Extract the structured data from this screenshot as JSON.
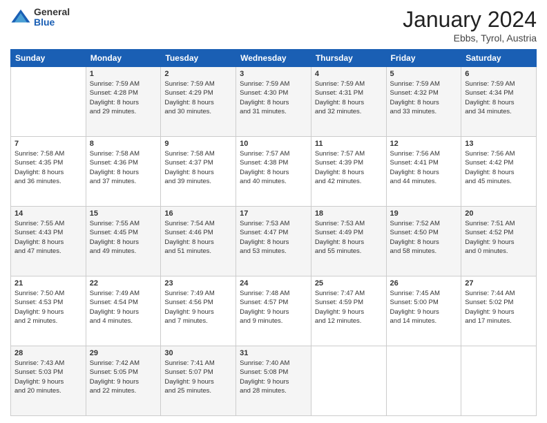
{
  "logo": {
    "general": "General",
    "blue": "Blue"
  },
  "header": {
    "month_year": "January 2024",
    "location": "Ebbs, Tyrol, Austria"
  },
  "weekdays": [
    "Sunday",
    "Monday",
    "Tuesday",
    "Wednesday",
    "Thursday",
    "Friday",
    "Saturday"
  ],
  "weeks": [
    [
      {
        "day": "",
        "info": ""
      },
      {
        "day": "1",
        "info": "Sunrise: 7:59 AM\nSunset: 4:28 PM\nDaylight: 8 hours\nand 29 minutes."
      },
      {
        "day": "2",
        "info": "Sunrise: 7:59 AM\nSunset: 4:29 PM\nDaylight: 8 hours\nand 30 minutes."
      },
      {
        "day": "3",
        "info": "Sunrise: 7:59 AM\nSunset: 4:30 PM\nDaylight: 8 hours\nand 31 minutes."
      },
      {
        "day": "4",
        "info": "Sunrise: 7:59 AM\nSunset: 4:31 PM\nDaylight: 8 hours\nand 32 minutes."
      },
      {
        "day": "5",
        "info": "Sunrise: 7:59 AM\nSunset: 4:32 PM\nDaylight: 8 hours\nand 33 minutes."
      },
      {
        "day": "6",
        "info": "Sunrise: 7:59 AM\nSunset: 4:34 PM\nDaylight: 8 hours\nand 34 minutes."
      }
    ],
    [
      {
        "day": "7",
        "info": "Sunrise: 7:58 AM\nSunset: 4:35 PM\nDaylight: 8 hours\nand 36 minutes."
      },
      {
        "day": "8",
        "info": "Sunrise: 7:58 AM\nSunset: 4:36 PM\nDaylight: 8 hours\nand 37 minutes."
      },
      {
        "day": "9",
        "info": "Sunrise: 7:58 AM\nSunset: 4:37 PM\nDaylight: 8 hours\nand 39 minutes."
      },
      {
        "day": "10",
        "info": "Sunrise: 7:57 AM\nSunset: 4:38 PM\nDaylight: 8 hours\nand 40 minutes."
      },
      {
        "day": "11",
        "info": "Sunrise: 7:57 AM\nSunset: 4:39 PM\nDaylight: 8 hours\nand 42 minutes."
      },
      {
        "day": "12",
        "info": "Sunrise: 7:56 AM\nSunset: 4:41 PM\nDaylight: 8 hours\nand 44 minutes."
      },
      {
        "day": "13",
        "info": "Sunrise: 7:56 AM\nSunset: 4:42 PM\nDaylight: 8 hours\nand 45 minutes."
      }
    ],
    [
      {
        "day": "14",
        "info": "Sunrise: 7:55 AM\nSunset: 4:43 PM\nDaylight: 8 hours\nand 47 minutes."
      },
      {
        "day": "15",
        "info": "Sunrise: 7:55 AM\nSunset: 4:45 PM\nDaylight: 8 hours\nand 49 minutes."
      },
      {
        "day": "16",
        "info": "Sunrise: 7:54 AM\nSunset: 4:46 PM\nDaylight: 8 hours\nand 51 minutes."
      },
      {
        "day": "17",
        "info": "Sunrise: 7:53 AM\nSunset: 4:47 PM\nDaylight: 8 hours\nand 53 minutes."
      },
      {
        "day": "18",
        "info": "Sunrise: 7:53 AM\nSunset: 4:49 PM\nDaylight: 8 hours\nand 55 minutes."
      },
      {
        "day": "19",
        "info": "Sunrise: 7:52 AM\nSunset: 4:50 PM\nDaylight: 8 hours\nand 58 minutes."
      },
      {
        "day": "20",
        "info": "Sunrise: 7:51 AM\nSunset: 4:52 PM\nDaylight: 9 hours\nand 0 minutes."
      }
    ],
    [
      {
        "day": "21",
        "info": "Sunrise: 7:50 AM\nSunset: 4:53 PM\nDaylight: 9 hours\nand 2 minutes."
      },
      {
        "day": "22",
        "info": "Sunrise: 7:49 AM\nSunset: 4:54 PM\nDaylight: 9 hours\nand 4 minutes."
      },
      {
        "day": "23",
        "info": "Sunrise: 7:49 AM\nSunset: 4:56 PM\nDaylight: 9 hours\nand 7 minutes."
      },
      {
        "day": "24",
        "info": "Sunrise: 7:48 AM\nSunset: 4:57 PM\nDaylight: 9 hours\nand 9 minutes."
      },
      {
        "day": "25",
        "info": "Sunrise: 7:47 AM\nSunset: 4:59 PM\nDaylight: 9 hours\nand 12 minutes."
      },
      {
        "day": "26",
        "info": "Sunrise: 7:45 AM\nSunset: 5:00 PM\nDaylight: 9 hours\nand 14 minutes."
      },
      {
        "day": "27",
        "info": "Sunrise: 7:44 AM\nSunset: 5:02 PM\nDaylight: 9 hours\nand 17 minutes."
      }
    ],
    [
      {
        "day": "28",
        "info": "Sunrise: 7:43 AM\nSunset: 5:03 PM\nDaylight: 9 hours\nand 20 minutes."
      },
      {
        "day": "29",
        "info": "Sunrise: 7:42 AM\nSunset: 5:05 PM\nDaylight: 9 hours\nand 22 minutes."
      },
      {
        "day": "30",
        "info": "Sunrise: 7:41 AM\nSunset: 5:07 PM\nDaylight: 9 hours\nand 25 minutes."
      },
      {
        "day": "31",
        "info": "Sunrise: 7:40 AM\nSunset: 5:08 PM\nDaylight: 9 hours\nand 28 minutes."
      },
      {
        "day": "",
        "info": ""
      },
      {
        "day": "",
        "info": ""
      },
      {
        "day": "",
        "info": ""
      }
    ]
  ]
}
